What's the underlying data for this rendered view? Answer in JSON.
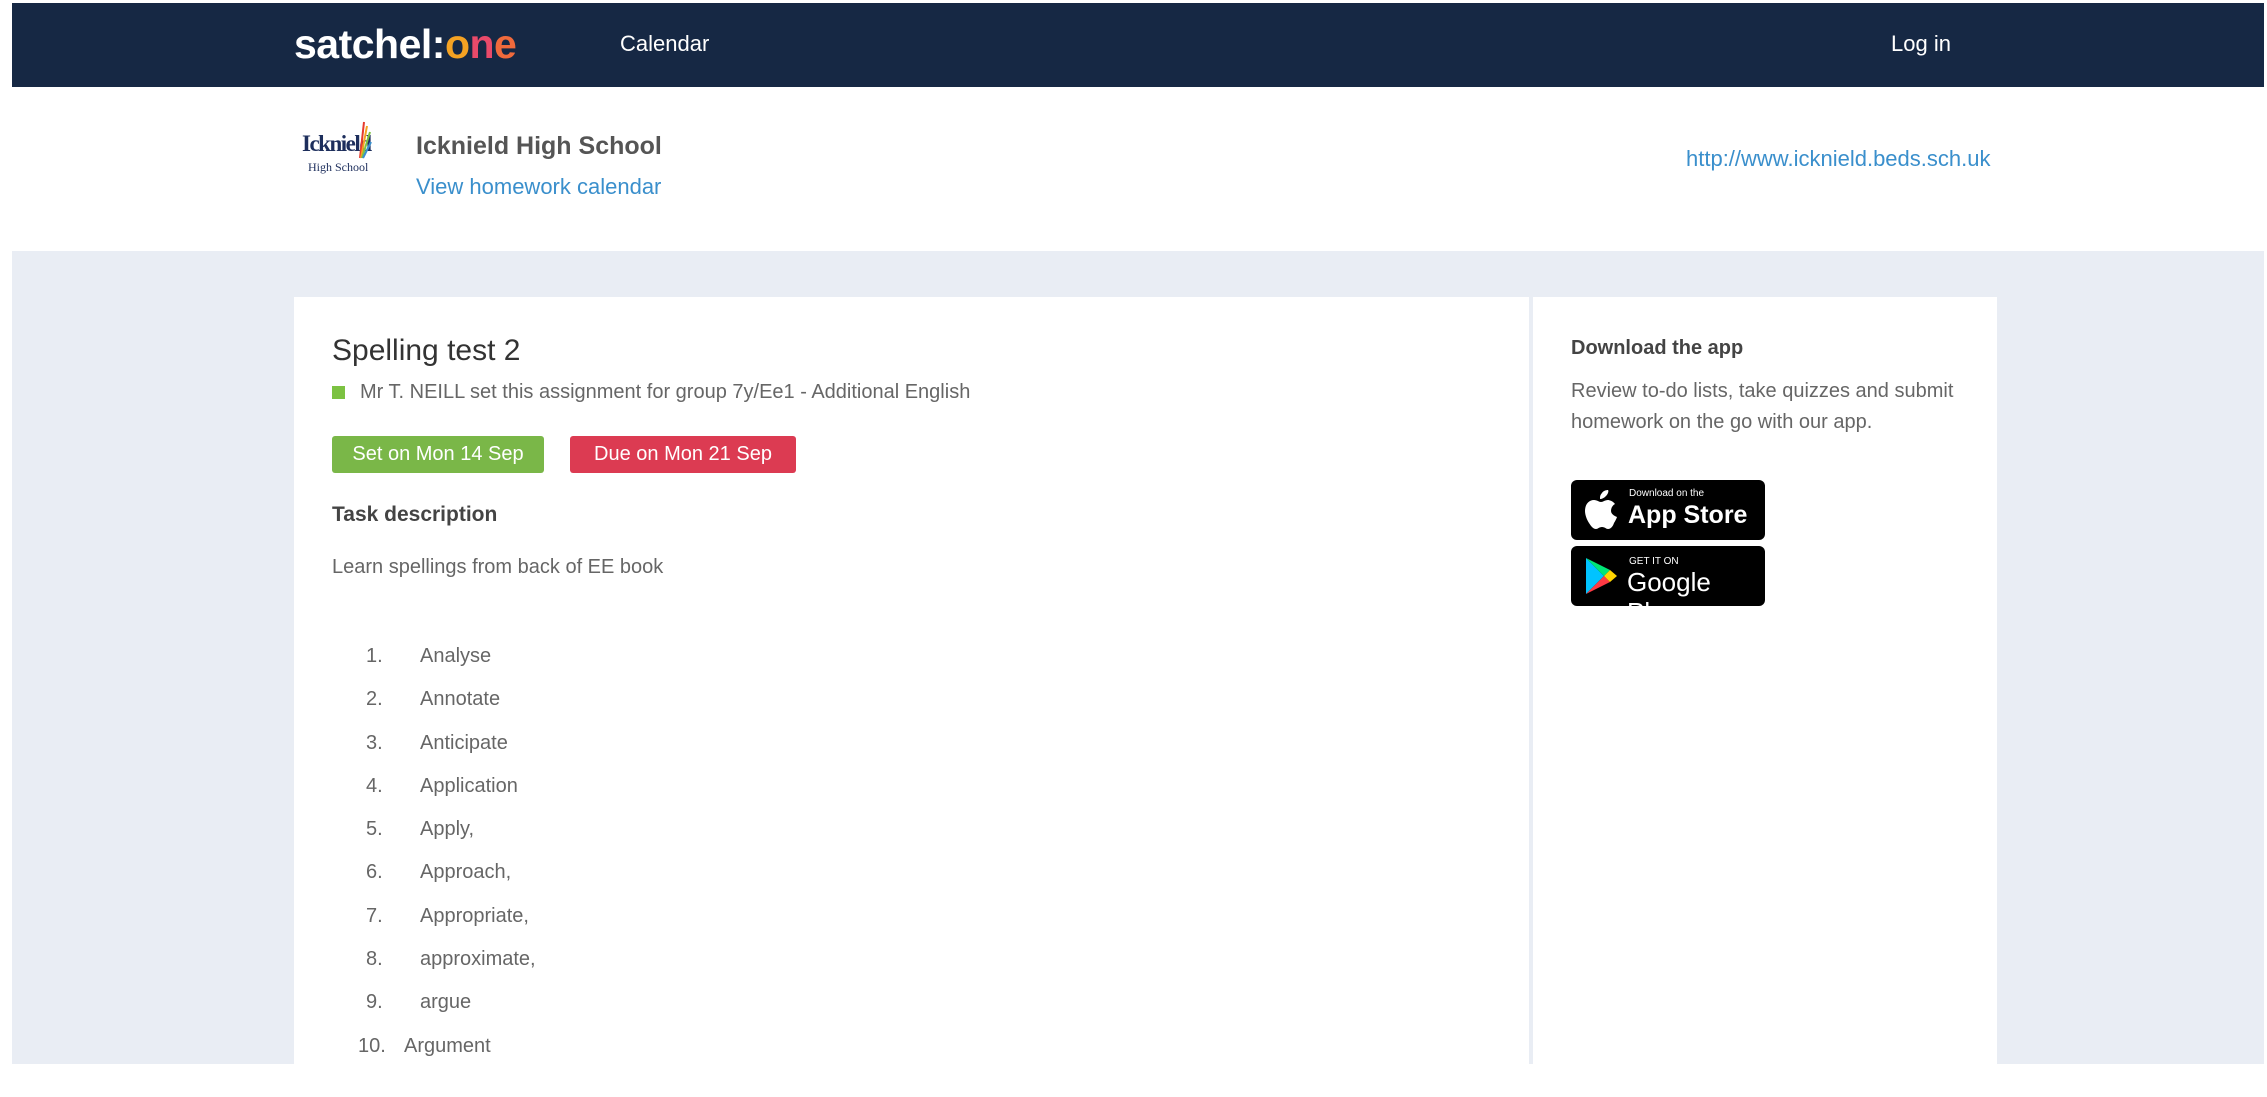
{
  "navbar": {
    "brand_prefix": "satchel:",
    "brand_o": "o",
    "brand_n": "n",
    "brand_e": "e",
    "calendar_label": "Calendar",
    "login_label": "Log in"
  },
  "school": {
    "logo_line1": "Icknield",
    "logo_line2": "High School",
    "name": "Icknield High School",
    "view_calendar": "View homework calendar",
    "url": "http://www.icknield.beds.sch.uk"
  },
  "assignment": {
    "title": "Spelling test 2",
    "set_by": "Mr T. NEILL set this assignment for group 7y/Ee1 - Additional English",
    "set_on": "Set on Mon 14 Sep",
    "due_on": "Due on Mon 21 Sep",
    "task_heading": "Task description",
    "task_text": "Learn spellings from back of EE book",
    "words": [
      {
        "num": "1.",
        "word": "Analyse"
      },
      {
        "num": "2.",
        "word": "Annotate"
      },
      {
        "num": "3.",
        "word": "Anticipate"
      },
      {
        "num": "4.",
        "word": "Application"
      },
      {
        "num": "5.",
        "word": "Apply,"
      },
      {
        "num": "6.",
        "word": "Approach,"
      },
      {
        "num": "7.",
        "word": "Appropriate,"
      },
      {
        "num": "8.",
        "word": "approximate,"
      },
      {
        "num": "9.",
        "word": "argue"
      },
      {
        "num": "10.",
        "word": "Argument"
      }
    ]
  },
  "sidebar": {
    "title": "Download the app",
    "text": "Review to-do lists, take quizzes and submit homework on the go with our app.",
    "app_store_small": "Download on the",
    "app_store_big": "App Store",
    "google_small": "GET IT ON",
    "google_big": "Google Play"
  },
  "colors": {
    "navbar": "#162844",
    "set_badge": "#7ab748",
    "due_badge": "#dc3b52",
    "link": "#3a8fcc",
    "page_bg": "#e9edf4"
  }
}
